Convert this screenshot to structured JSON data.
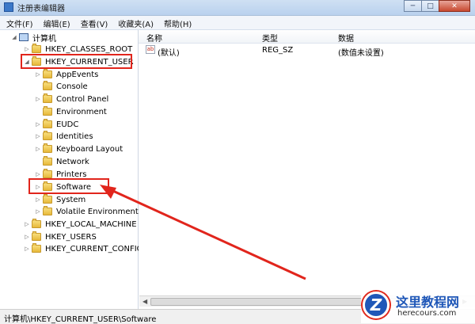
{
  "window": {
    "title": "注册表编辑器"
  },
  "menu": [
    "文件(F)",
    "编辑(E)",
    "查看(V)",
    "收藏夹(A)",
    "帮助(H)"
  ],
  "tree": {
    "root": "计算机",
    "hives": [
      "HKEY_CLASSES_ROOT",
      "HKEY_CURRENT_USER",
      "HKEY_LOCAL_MACHINE",
      "HKEY_USERS",
      "HKEY_CURRENT_CONFIG"
    ],
    "current_user_children": [
      "AppEvents",
      "Console",
      "Control Panel",
      "Environment",
      "EUDC",
      "Identities",
      "Keyboard Layout",
      "Network",
      "Printers",
      "Software",
      "System",
      "Volatile Environment"
    ],
    "selected": "Software",
    "highlight_color": "#e1251c"
  },
  "list": {
    "columns": [
      "名称",
      "类型",
      "数据"
    ],
    "rows": [
      {
        "name": "(默认)",
        "type": "REG_SZ",
        "data": "(数值未设置)"
      }
    ]
  },
  "status": "计算机\\HKEY_CURRENT_USER\\Software",
  "watermark": {
    "logo_letter": "Z",
    "text": "这里教程网",
    "url": "herecours.com"
  }
}
